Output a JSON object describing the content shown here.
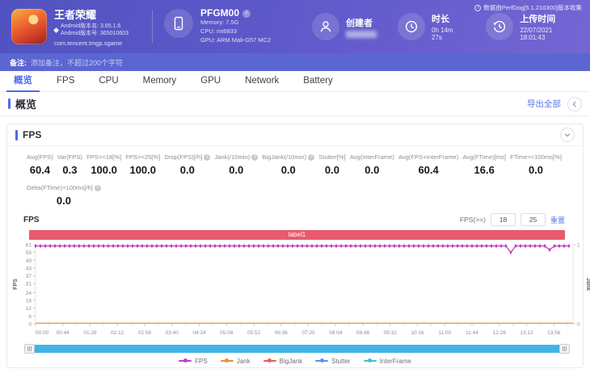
{
  "header": {
    "collector_note": "数据由PerfDog[5.1.210300]版本收集",
    "app": {
      "title": "王者荣耀",
      "version_name": "Android版本名: 3.65.1.6",
      "version_code": "Android版本号: 365010603",
      "package": "com.tencent.tmgp.sgame"
    },
    "device": {
      "name": "PFGM00",
      "memory": "Memory: 7.5G",
      "cpu": "CPU: mt6833",
      "gpu": "GPU: ARM Mali-G57 MC2"
    },
    "creator_label": "创建者",
    "duration_label": "时长",
    "duration_value": "0h 14m 27s",
    "upload_label": "上传时间",
    "upload_value": "22/07/2021 18:01:43"
  },
  "remarks": {
    "label": "备注:",
    "placeholder": "添加备注，不超过200个字符"
  },
  "tabs": [
    "概览",
    "FPS",
    "CPU",
    "Memory",
    "GPU",
    "Network",
    "Battery"
  ],
  "active_tab": "概览",
  "overview": {
    "title": "概览",
    "export_all_label": "导出全部"
  },
  "fps_panel": {
    "title": "FPS",
    "chart_title": "FPS",
    "stats_row1": [
      {
        "label": "Avg(FPS)",
        "value": "60.4",
        "info": false
      },
      {
        "label": "Var(FPS)",
        "value": "0.3",
        "info": false
      },
      {
        "label": "FPS>=18[%]",
        "value": "100.0",
        "info": false
      },
      {
        "label": "FPS>=25[%]",
        "value": "100.0",
        "info": false
      },
      {
        "label": "Drop(FPS)[/h]",
        "value": "0.0",
        "info": true
      },
      {
        "label": "Jank(/10min)",
        "value": "0.0",
        "info": true
      },
      {
        "label": "BigJank(/10min)",
        "value": "0.0",
        "info": true
      },
      {
        "label": "Stutter[%]",
        "value": "0.0",
        "info": false
      },
      {
        "label": "Avg(InterFrame)",
        "value": "0.0",
        "info": false
      },
      {
        "label": "Avg(FPS+InterFrame)",
        "value": "60.4",
        "info": false
      },
      {
        "label": "Avg(FTime)[ms]",
        "value": "16.6",
        "info": false
      },
      {
        "label": "FTime>=100ms[%]",
        "value": "0.0",
        "info": false
      }
    ],
    "stats_row2": [
      {
        "label": "Delta(FTime)>100ms[/h]",
        "value": "0.0",
        "info": true
      }
    ],
    "threshold": {
      "label": "FPS(>=)",
      "low": "18",
      "high": "25",
      "reset_label": "重置"
    }
  },
  "chart_data": {
    "type": "line",
    "banner_label": "label1",
    "left_axis": {
      "label": "FPS",
      "ticks": [
        0,
        6,
        12,
        18,
        24,
        31,
        37,
        43,
        49,
        55,
        61
      ],
      "range": [
        0,
        61
      ]
    },
    "right_axis": {
      "label": "Jank",
      "ticks": [
        0,
        1
      ],
      "range": [
        0,
        1
      ]
    },
    "x_ticks": [
      "00:00",
      "00:44",
      "01:28",
      "02:12",
      "02:56",
      "03:40",
      "04:24",
      "05:08",
      "05:52",
      "06:36",
      "07:20",
      "08:04",
      "08:48",
      "09:32",
      "10:16",
      "11:00",
      "11:44",
      "12:28",
      "13:12",
      "13:56"
    ],
    "x_tick_interval_seconds": 44,
    "x_range_seconds": [
      0,
      867
    ],
    "series": [
      {
        "name": "FPS",
        "color": "#c53bc5",
        "axis": "left",
        "baseline": 60,
        "dips": [
          {
            "time_seconds": 764,
            "value": 55
          },
          {
            "time_seconds": 830,
            "value": 57
          }
        ]
      },
      {
        "name": "Jank",
        "color": "#ef8b3f",
        "axis": "right",
        "baseline": 0,
        "dips": []
      },
      {
        "name": "BigJank",
        "color": "#e95d5d",
        "axis": "right",
        "baseline": 0,
        "dips": []
      },
      {
        "name": "Stutter",
        "color": "#5b8ff9",
        "axis": "left",
        "baseline": 0,
        "dips": []
      },
      {
        "name": "InterFrame",
        "color": "#3ec6c6",
        "axis": "left",
        "baseline": 0,
        "dips": []
      }
    ],
    "legend": [
      "FPS",
      "Jank",
      "BigJank",
      "Stutter",
      "InterFrame"
    ]
  },
  "colors": {
    "accent_blue": "#4f6be8",
    "banner_red": "#e85a6e",
    "brush_cyan": "#40b2e9",
    "header_gradient_start": "#5153c1",
    "header_gradient_end": "#7466d4"
  }
}
